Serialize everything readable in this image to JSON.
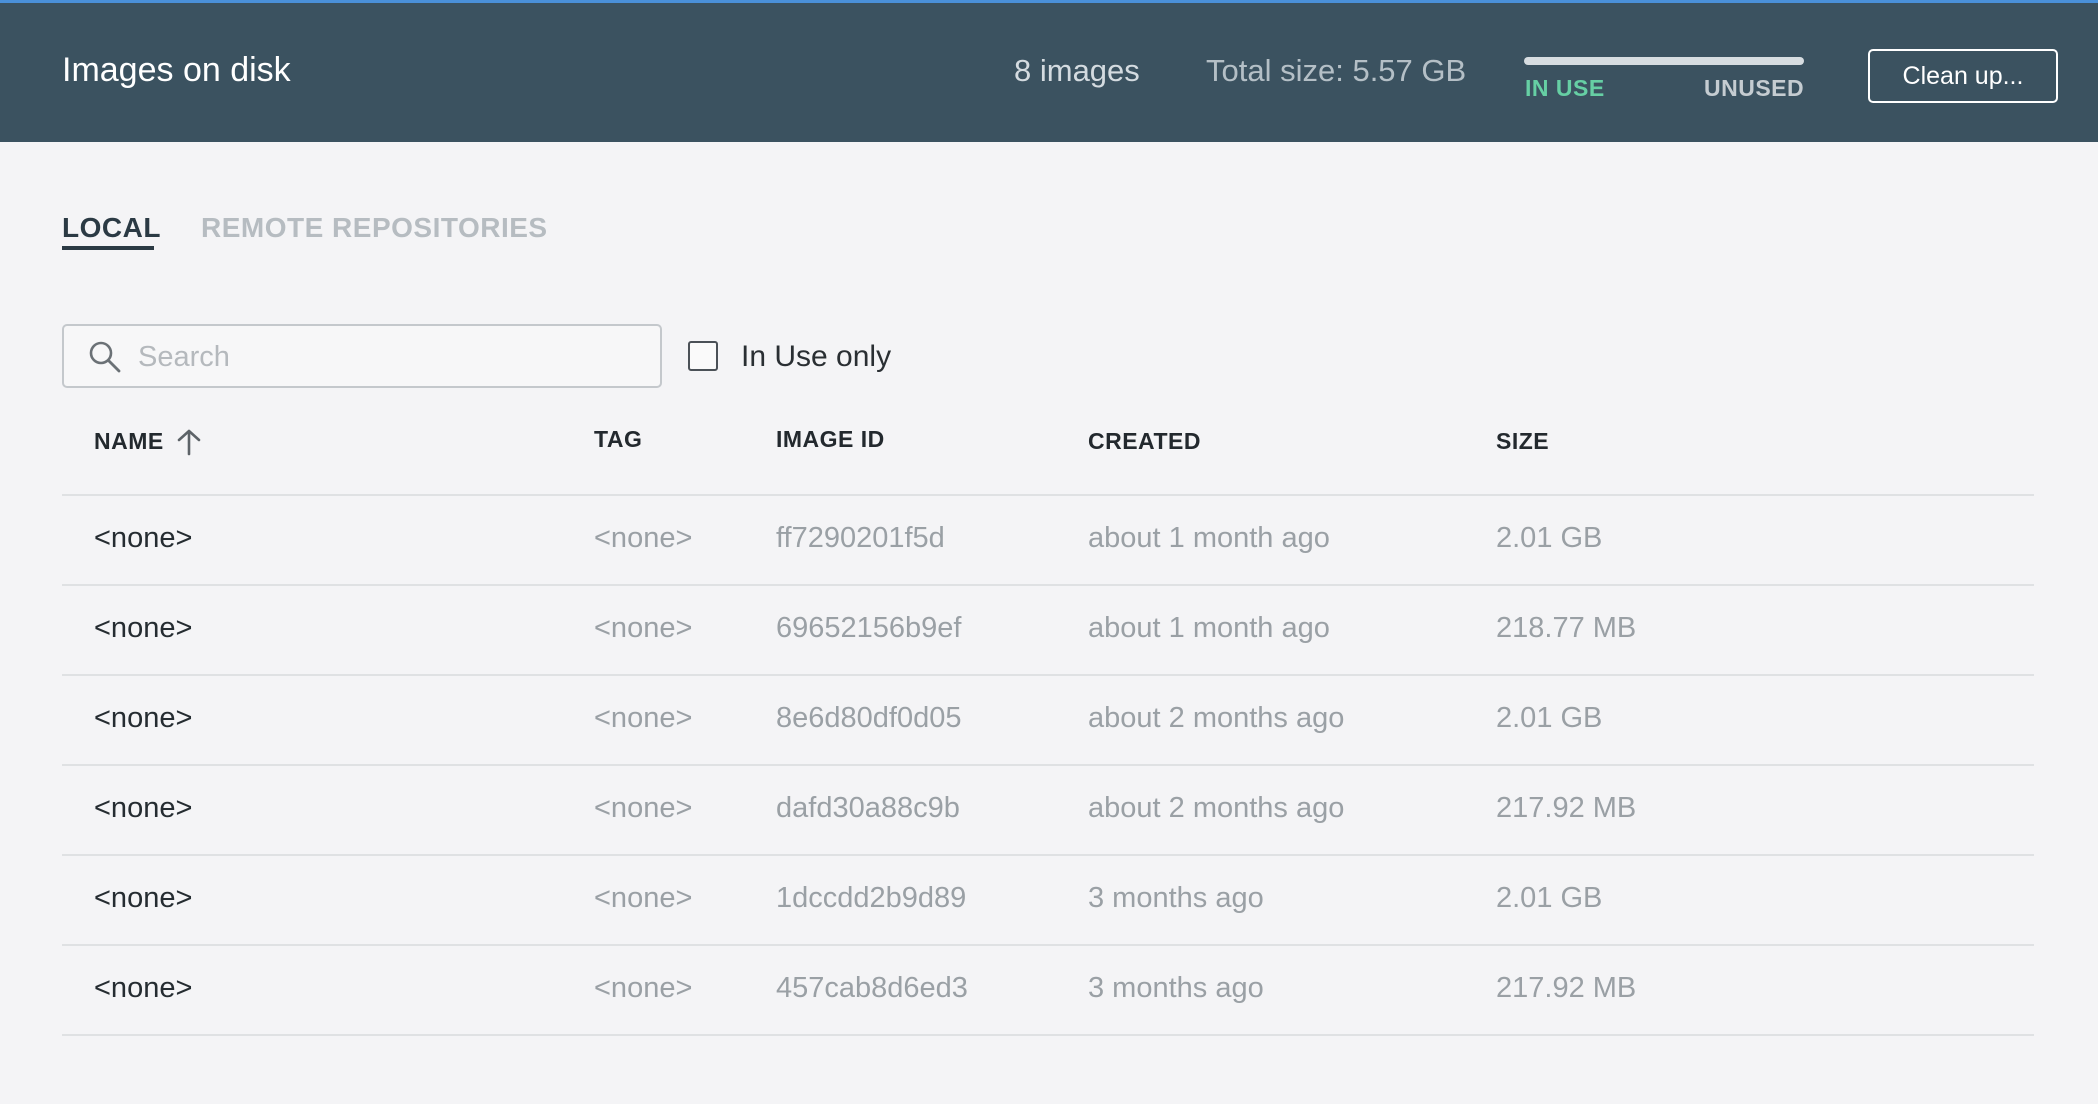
{
  "header": {
    "title": "Images on disk",
    "count": "8 images",
    "total_size": "Total size: 5.57 GB",
    "usage": {
      "in_use_label": "IN USE",
      "unused_label": "UNUSED",
      "in_use_fraction": 0.0,
      "in_use_color": "#5cc9a0"
    },
    "cleanup_label": "Clean up..."
  },
  "tabs": [
    {
      "label": "LOCAL",
      "active": true
    },
    {
      "label": "REMOTE REPOSITORIES",
      "active": false
    }
  ],
  "search": {
    "placeholder": "Search",
    "value": "",
    "icon": "search-icon"
  },
  "filter": {
    "label": "In Use only",
    "checked": false
  },
  "table": {
    "columns": [
      "NAME",
      "TAG",
      "IMAGE ID",
      "CREATED",
      "SIZE"
    ],
    "sort_icon": "arrow-up-icon",
    "rows": [
      {
        "name": "<none>",
        "tag": "<none>",
        "image_id": "ff7290201f5d",
        "created": "about 1 month ago",
        "size": "2.01 GB"
      },
      {
        "name": "<none>",
        "tag": "<none>",
        "image_id": "69652156b9ef",
        "created": "about 1 month ago",
        "size": "218.77 MB"
      },
      {
        "name": "<none>",
        "tag": "<none>",
        "image_id": "8e6d80df0d05",
        "created": "about 2 months ago",
        "size": "2.01 GB"
      },
      {
        "name": "<none>",
        "tag": "<none>",
        "image_id": "dafd30a88c9b",
        "created": "about 2 months ago",
        "size": "217.92 MB"
      },
      {
        "name": "<none>",
        "tag": "<none>",
        "image_id": "1dccdd2b9d89",
        "created": "3 months ago",
        "size": "2.01 GB"
      },
      {
        "name": "<none>",
        "tag": "<none>",
        "image_id": "457cab8d6ed3",
        "created": "3 months ago",
        "size": "217.92 MB"
      }
    ]
  }
}
